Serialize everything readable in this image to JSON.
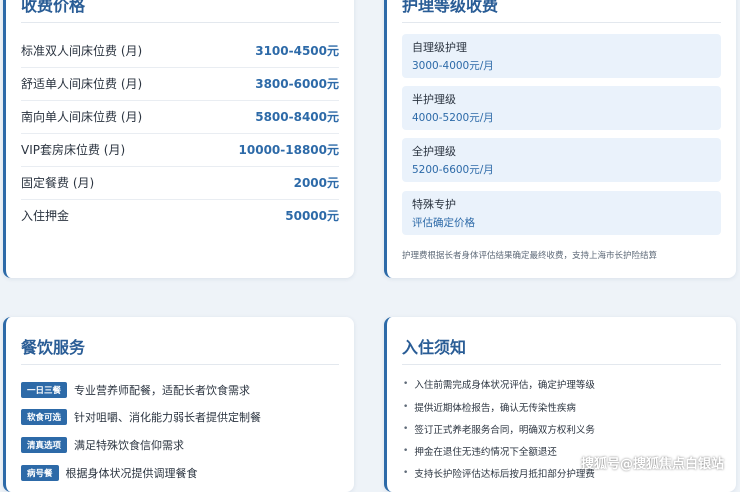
{
  "fees_card": {
    "title": "收费价格",
    "rows": [
      {
        "label": "标准双人间床位费 (月)",
        "value": "3100-4500元"
      },
      {
        "label": "舒适单人间床位费 (月)",
        "value": "3800-6000元"
      },
      {
        "label": "南向单人间床位费 (月)",
        "value": "5800-8400元"
      },
      {
        "label": "VIP套房床位费 (月)",
        "value": "10000-18800元"
      },
      {
        "label": "固定餐费 (月)",
        "value": "2000元"
      },
      {
        "label": "入住押金",
        "value": "50000元"
      }
    ]
  },
  "care_card": {
    "title": "护理等级收费",
    "levels": [
      {
        "name": "自理级护理",
        "price": "3000-4000元/月"
      },
      {
        "name": "半护理级",
        "price": "4000-5200元/月"
      },
      {
        "name": "全护理级",
        "price": "5200-6600元/月"
      },
      {
        "name": "特殊专护",
        "price": "评估确定价格"
      }
    ],
    "note": "护理费根据长者身体评估结果确定最终收费，支持上海市长护险结算"
  },
  "dining_card": {
    "title": "餐饮服务",
    "items": [
      {
        "tag": "一日三餐",
        "text": "专业营养师配餐，适配长者饮食需求"
      },
      {
        "tag": "软食可选",
        "text": "针对咀嚼、消化能力弱长者提供定制餐"
      },
      {
        "tag": "清真选项",
        "text": "满足特殊饮食信仰需求"
      },
      {
        "tag": "病号餐",
        "text": "根据身体状况提供调理餐食"
      }
    ]
  },
  "notice_card": {
    "title": "入住须知",
    "items": [
      "入住前需完成身体状况评估，确定护理等级",
      "提供近期体检报告，确认无传染性疾病",
      "签订正式养老服务合同，明确双方权利义务",
      "押金在退住无违约情况下全额退还",
      "支持长护险评估达标后按月抵扣部分护理费"
    ]
  },
  "watermark": "搜狐号@搜狐焦点白银站"
}
